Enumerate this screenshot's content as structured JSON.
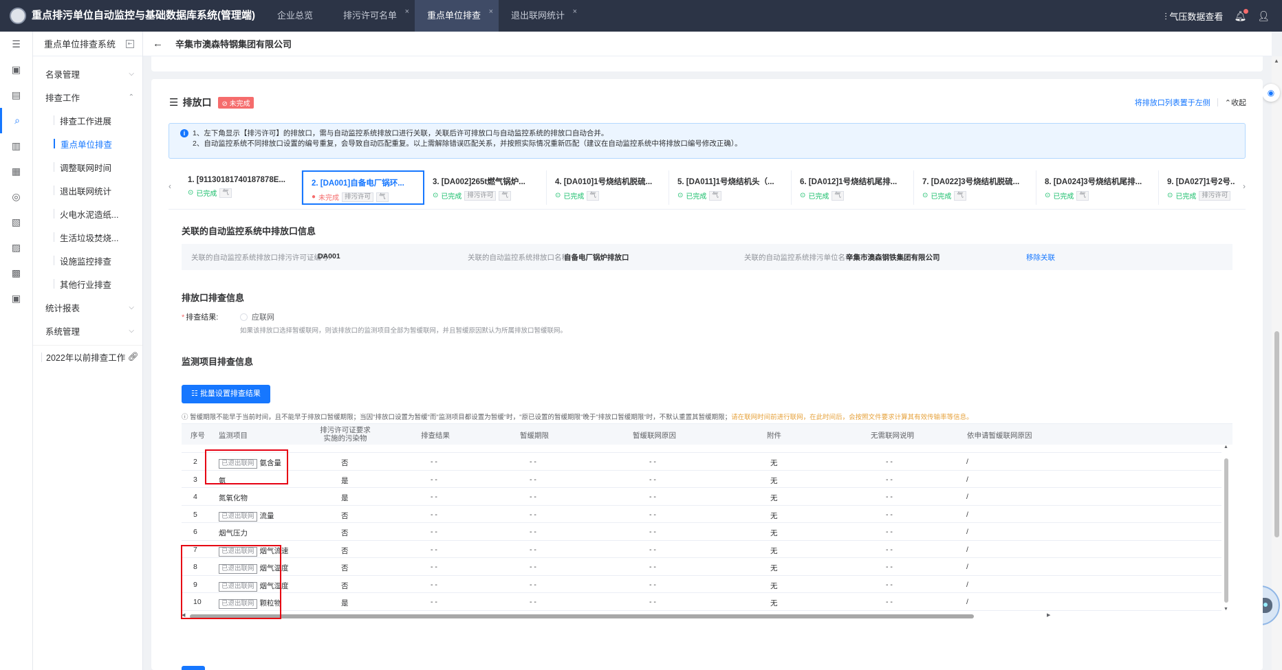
{
  "topbar": {
    "app_title": "重点排污单位自动监控与基础数据库系统(管理端)",
    "tabs": [
      {
        "label": "企业总览",
        "active": false,
        "closable": false
      },
      {
        "label": "排污许可名单",
        "active": false,
        "closable": true
      },
      {
        "label": "重点单位排查",
        "active": true,
        "closable": true
      },
      {
        "label": "退出联网统计",
        "active": false,
        "closable": true
      }
    ],
    "weather_label": "气压数据查看",
    "close_glyph": "×"
  },
  "nav": {
    "title": "重点单位排查系统",
    "items": [
      {
        "label": "名录管理",
        "type": "group"
      },
      {
        "label": "排查工作",
        "type": "group-open"
      },
      {
        "label": "排查工作进展",
        "type": "sub"
      },
      {
        "label": "重点单位排查",
        "type": "sub",
        "active": true
      },
      {
        "label": "调整联网时间",
        "type": "sub"
      },
      {
        "label": "退出联网统计",
        "type": "sub"
      },
      {
        "label": "火电水泥造纸...",
        "type": "sub"
      },
      {
        "label": "生活垃圾焚烧...",
        "type": "sub"
      },
      {
        "label": "设施监控排查",
        "type": "sub"
      },
      {
        "label": "其他行业排查",
        "type": "sub"
      },
      {
        "label": "统计报表",
        "type": "group"
      },
      {
        "label": "系统管理",
        "type": "group"
      }
    ],
    "extra_link": "2022年以前排查工作"
  },
  "breadcrumb": {
    "back": "←",
    "company": "辛集市澳森特钢集团有限公司"
  },
  "section": {
    "title": "排放口",
    "status_badge": "未完成",
    "move_left_link": "将排放口列表置于左侧",
    "collapse_label": "收起"
  },
  "notice": {
    "line1": "1、左下角显示【排污许可】的排放口，需与自动监控系统排放口进行关联，关联后许可排放口与自动监控系统的排放口自动合并。",
    "line2": "2、自动监控系统不同排放口设置的编号重复，会导致自动匹配重复。以上需解除错误匹配关系，并按照实际情况重新匹配（建议在自动监控系统中将排放口编号修改正确）。"
  },
  "outlet_tabs": [
    {
      "title": "1. [911301817401878​78E...",
      "status": "已完成",
      "ok": true,
      "tags": [
        "气"
      ]
    },
    {
      "title": "2. [DA001]自备电厂锅环...",
      "status": "未完成",
      "ok": false,
      "tags": [
        "排污许可",
        "气"
      ],
      "active": true
    },
    {
      "title": "3. [DA002]265t燃气锅炉...",
      "status": "已完成",
      "ok": true,
      "tags": [
        "排污许可",
        "气"
      ]
    },
    {
      "title": "4. [DA010]1号烧结机脱硫...",
      "status": "已完成",
      "ok": true,
      "tags": [
        "气"
      ]
    },
    {
      "title": "5. [DA011]1号烧结机头（...",
      "status": "已完成",
      "ok": true,
      "tags": [
        "气"
      ]
    },
    {
      "title": "6. [DA012]1号烧结机尾排...",
      "status": "已完成",
      "ok": true,
      "tags": [
        "气"
      ]
    },
    {
      "title": "7. [DA022]3号烧结机脱硫...",
      "status": "已完成",
      "ok": true,
      "tags": [
        "气"
      ]
    },
    {
      "title": "8. [DA024]3号烧结机尾排...",
      "status": "已完成",
      "ok": true,
      "tags": [
        "气"
      ]
    },
    {
      "title": "9. [DA027]1号2号...",
      "status": "已完成",
      "ok": true,
      "tags": [
        "排污许可"
      ]
    }
  ],
  "assoc": {
    "heading": "关联的自动监控系统中排放口信息",
    "k1": "关联的自动监控系统排放口排污许可证编号:",
    "v1": "DA001",
    "k2": "关联的自动监控系统排放口名称:",
    "v2": "自备电厂锅炉排放口",
    "k3": "关联的自动监控系统排污单位名称:",
    "v3": "辛集市澳森钢铁集团有限公司",
    "remove": "移除关联"
  },
  "check": {
    "heading": "排放口排查信息",
    "result_label": "排查结果:",
    "required_mark": "*",
    "radio_label": "应联网",
    "hint": "如果该排放口选择暂缓联网，则该排放口的监测项目全部为暂缓联网，并且暂缓原因默认为所属排放口暂缓联网。"
  },
  "monitor": {
    "heading": "监测项目排查信息",
    "batch_button": "批量设置排查结果",
    "tip_main": "暂缓期限不能早于当前时间，且不能早于排放口暂缓期限；当因\"排放口设置为暂缓\"而\"监测项目都设置为暂缓\"时，\"原已设置的暂缓期限\"晚于\"排放口暂缓期限\"时，不默认重置其暂缓期限；",
    "tip_warn": "请在联网时间前进行联网，在此时间后，会按照文件要求计算其有效传输率等信息。",
    "columns": [
      "序号",
      "监测项目",
      "排污许可证要求实施的污染物",
      "排查结果",
      "暂缓期限",
      "暂缓联网原因",
      "附件",
      "无需联网说明",
      "依申请暂缓联网原因"
    ],
    "rows": [
      {
        "no": "2",
        "tag": "已退出联网",
        "item": "氨含量",
        "req": "否",
        "result": "- -",
        "deadline": "- -",
        "reason": "- -",
        "attach": "无",
        "nonet": "- -",
        "apply": "/"
      },
      {
        "no": "3",
        "tag": "",
        "item": "氨",
        "req": "是",
        "result": "- -",
        "deadline": "- -",
        "reason": "- -",
        "attach": "无",
        "nonet": "- -",
        "apply": "/"
      },
      {
        "no": "4",
        "tag": "",
        "item": "氮氧化物",
        "req": "是",
        "result": "- -",
        "deadline": "- -",
        "reason": "- -",
        "attach": "无",
        "nonet": "- -",
        "apply": "/"
      },
      {
        "no": "5",
        "tag": "已退出联网",
        "item": "流量",
        "req": "否",
        "result": "- -",
        "deadline": "- -",
        "reason": "- -",
        "attach": "无",
        "nonet": "- -",
        "apply": "/"
      },
      {
        "no": "6",
        "tag": "",
        "item": "烟气压力",
        "req": "否",
        "result": "- -",
        "deadline": "- -",
        "reason": "- -",
        "attach": "无",
        "nonet": "- -",
        "apply": "/"
      },
      {
        "no": "7",
        "tag": "已退出联网",
        "item": "烟气流速",
        "req": "否",
        "result": "- -",
        "deadline": "- -",
        "reason": "- -",
        "attach": "无",
        "nonet": "- -",
        "apply": "/"
      },
      {
        "no": "8",
        "tag": "已退出联网",
        "item": "烟气温度",
        "req": "否",
        "result": "- -",
        "deadline": "- -",
        "reason": "- -",
        "attach": "无",
        "nonet": "- -",
        "apply": "/"
      },
      {
        "no": "9",
        "tag": "已退出联网",
        "item": "烟气湿度",
        "req": "否",
        "result": "- -",
        "deadline": "- -",
        "reason": "- -",
        "attach": "无",
        "nonet": "- -",
        "apply": "/"
      },
      {
        "no": "10",
        "tag": "已退出联网",
        "item": "颗粒物",
        "req": "是",
        "result": "- -",
        "deadline": "- -",
        "reason": "- -",
        "attach": "无",
        "nonet": "- -",
        "apply": "/"
      }
    ]
  },
  "colors": {
    "primary": "#1677ff",
    "topbar": "#2c3446",
    "ok": "#19be6b",
    "danger": "#f56c6c",
    "highlight": "#e60012"
  }
}
